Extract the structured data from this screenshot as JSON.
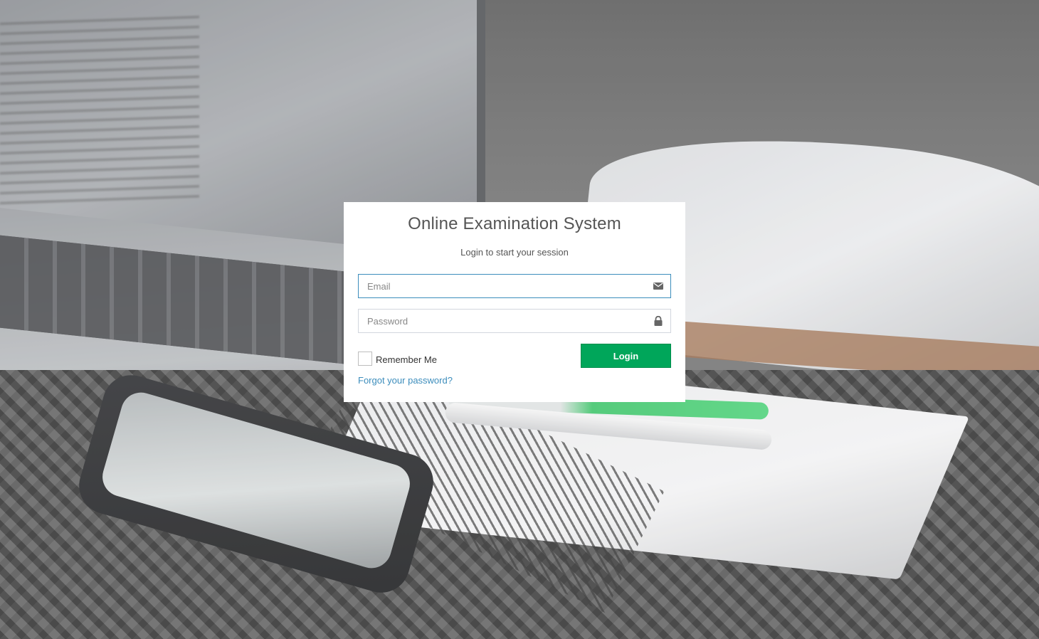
{
  "login": {
    "title": "Online Examination System",
    "subtitle": "Login to start your session",
    "email_placeholder": "Email",
    "password_placeholder": "Password",
    "remember_label": "Remember Me",
    "remember_checked": false,
    "login_button": "Login",
    "forgot_link": "Forgot your password?"
  },
  "icons": {
    "email": "envelope-icon",
    "password": "lock-icon"
  },
  "colors": {
    "login_button": "#00a65a",
    "link": "#3c8dbc",
    "focus_border": "#3c8dbc"
  }
}
